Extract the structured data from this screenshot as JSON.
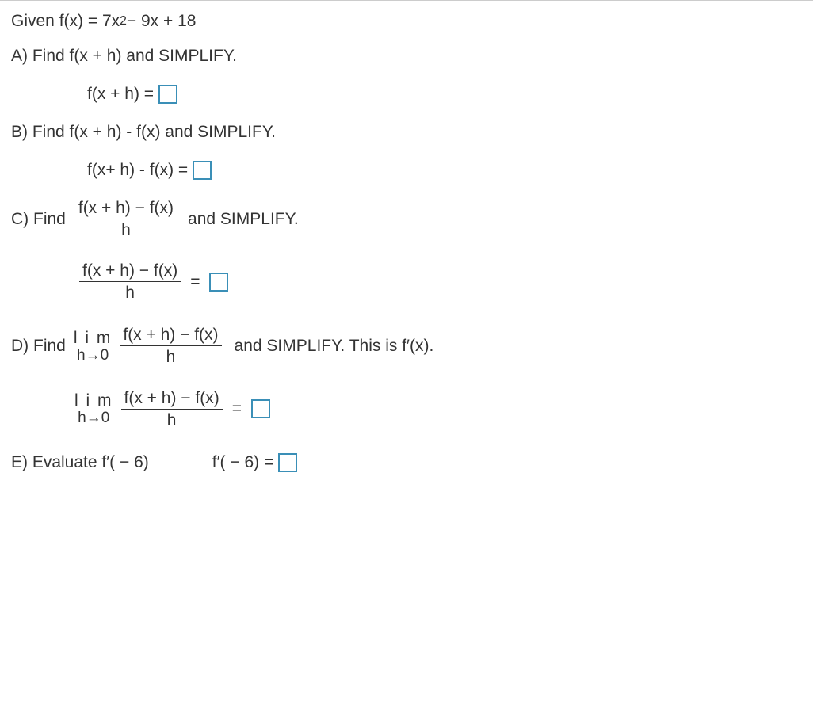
{
  "given": {
    "prefix": "Given f(x) = 7x",
    "exp": "2",
    "suffix": " − 9x + 18"
  },
  "partA": {
    "prompt": "A) Find f(x + h) and SIMPLIFY.",
    "lhs": "f(x + h) ="
  },
  "partB": {
    "prompt": "B) Find f(x + h) - f(x)  and SIMPLIFY.",
    "lhs": "f(x+ h) - f(x) ="
  },
  "partC": {
    "prefix": "C) Find",
    "suffix": "and SIMPLIFY.",
    "frac_num": "f(x + h) − f(x)",
    "frac_den": "h",
    "ans_num": "f(x + h) − f(x)",
    "ans_den": "h",
    "eq": "="
  },
  "partD": {
    "prefix": "D) Find",
    "lim_top": "l i m",
    "lim_bot": "h→0",
    "frac_num": "f(x + h) − f(x)",
    "frac_den": "h",
    "suffix": "and SIMPLIFY.  This is f′(x).",
    "eq": "="
  },
  "partE": {
    "prompt": "E) Evaluate f′( − 6)",
    "rhs": "f′( − 6) ="
  }
}
